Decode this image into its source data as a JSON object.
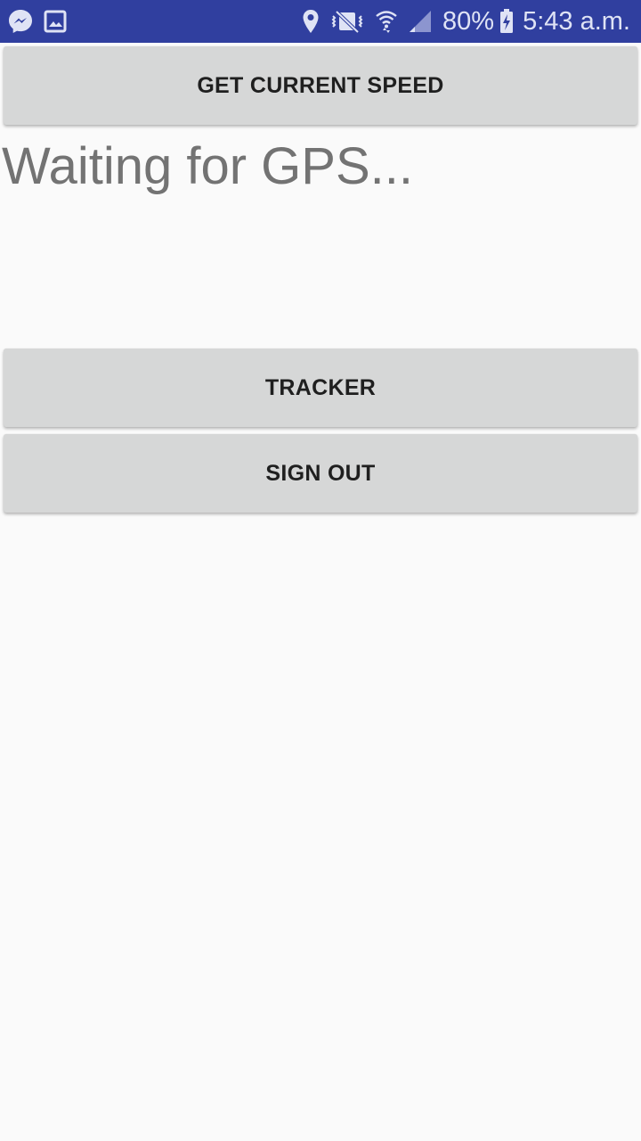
{
  "status_bar": {
    "notification_icons": [
      "messenger-icon",
      "gallery-icon"
    ],
    "system_icons": [
      "location-icon",
      "vibrate-icon",
      "wifi-icon",
      "cell-signal-icon",
      "battery-charging-icon"
    ],
    "battery_percent": "80%",
    "time": "5:43 a.m.",
    "bar_color": "#303f9f"
  },
  "main": {
    "get_speed_button": "GET CURRENT SPEED",
    "gps_status": "Waiting for GPS...",
    "tracker_button": "TRACKER",
    "sign_out_button": "SIGN OUT"
  },
  "colors": {
    "background": "#fafafa",
    "button_bg": "#d6d7d7",
    "button_text": "#1f1f1f",
    "status_text": "#737373"
  }
}
